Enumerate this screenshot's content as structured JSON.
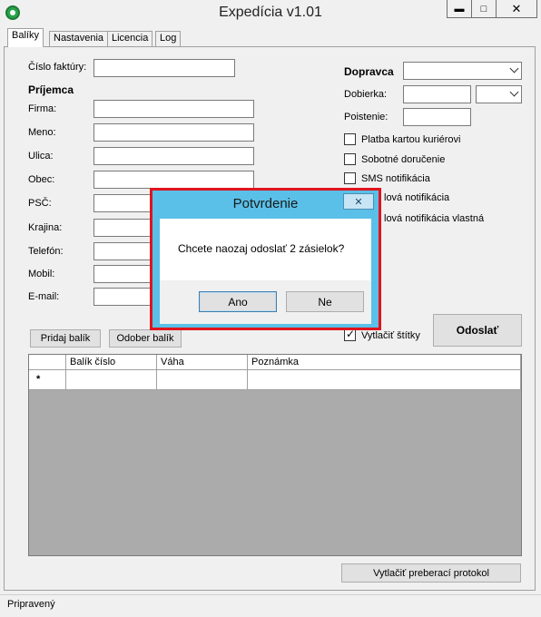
{
  "window": {
    "title": "Expedícia v1.01",
    "min": "▬",
    "max": "□",
    "close": "✕"
  },
  "tabs": [
    "Balíky",
    "Nastavenia",
    "Licencia",
    "Log"
  ],
  "form": {
    "invoice_label": "Číslo faktúry:",
    "recipient_header": "Príjemca",
    "fields": [
      "Firma:",
      "Meno:",
      "Ulica:",
      "Obec:",
      "PSČ:",
      "Krajina:",
      "Telefón:",
      "Mobil:",
      "E-mail:"
    ]
  },
  "carrier": {
    "header": "Dopravca",
    "cod_label": "Dobierka:",
    "insurance_label": "Poistenie:",
    "options": [
      {
        "label": "Platba kartou kuriérovi",
        "checked": false
      },
      {
        "label": "Sobotné doručenie",
        "checked": false
      },
      {
        "label": "SMS notifikácia",
        "checked": false
      },
      {
        "label": "lová notifikácia",
        "checked": false
      },
      {
        "label": "lová notifikácia vlastná",
        "checked": false
      }
    ],
    "print_labels": {
      "label": "Vytlačiť štítky",
      "checked": true
    }
  },
  "buttons": {
    "add_package": "Pridaj balík",
    "remove_package": "Odober balík",
    "send": "Odoslať",
    "print_protocol": "Vytlačiť preberací protokol"
  },
  "grid": {
    "columns": [
      "Balík číslo",
      "Váha",
      "Poznámka"
    ],
    "new_row_marker": "*"
  },
  "status": "Pripravený",
  "dialog": {
    "title": "Potvrdenie",
    "close": "✕",
    "message": "Chcete naozaj odoslať 2 zásielok?",
    "yes": "Ano",
    "no": "Ne"
  },
  "colors": {
    "dialog_border": "#e0141e",
    "dialog_title_bg": "#5ac0e8",
    "grid_bg": "#ababab"
  }
}
